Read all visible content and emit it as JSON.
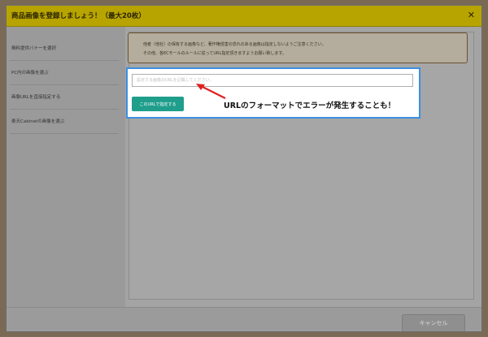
{
  "dialog": {
    "title": "商品画像を登録しましょう！（最大20枚）",
    "close_icon": "✕"
  },
  "sidebar": {
    "items": [
      {
        "label": "無料提供バナーを選択"
      },
      {
        "label": "PC内の画像を選ぶ"
      },
      {
        "label": "画像URLを直接指定する"
      },
      {
        "label": "楽天Cabinetの画像を選ぶ"
      }
    ]
  },
  "notice": {
    "line1": "他者（他社）の保有する画像など、著作権侵害の恐れのある画像は指定しないようご注意ください。",
    "line2": "その他、各ECモールのルールに従ってURL指定頂きますようお願い致します。"
  },
  "url_form": {
    "placeholder": "設定する画像のURLを記載してください。",
    "submit_label": "このURLで指定する"
  },
  "annotation": {
    "text": "URLのフォーマットでエラーが発生することも！",
    "arrow_color": "#e02020"
  },
  "footer": {
    "cancel_label": "キャンセル"
  },
  "colors": {
    "title_bar": "#b7a400",
    "accent_button": "#1f9e8c",
    "highlight_border": "#3b8fe0"
  }
}
